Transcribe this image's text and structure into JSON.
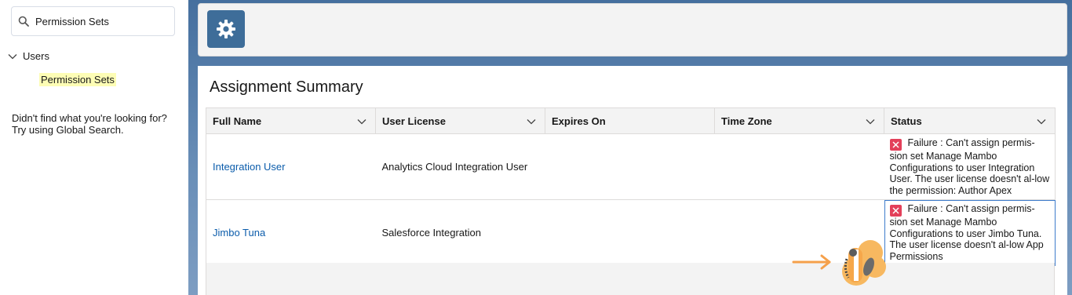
{
  "search": {
    "value": "Permission Sets"
  },
  "tree": {
    "parent_label": "Users",
    "child_label": "Permission Sets"
  },
  "help": {
    "line1": "Didn't find what you're looking for?",
    "line2": "Try using Global Search."
  },
  "page": {
    "title": "Assignment Summary"
  },
  "table": {
    "columns": [
      "Full Name",
      "User License",
      "Expires On",
      "Time Zone",
      "Status"
    ],
    "rows": [
      {
        "full_name": "Integration User",
        "user_license": "Analytics Cloud Integration User",
        "expires_on": "",
        "time_zone": "",
        "status": "Failure : Can't assign permis-sion set Manage Mambo Configurations to user Integration User. The user license doesn't al-low the permission: Author Apex"
      },
      {
        "full_name": "Jimbo Tuna",
        "user_license": "Salesforce Integration",
        "expires_on": "",
        "time_zone": "",
        "status": "Failure : Can't assign permis-sion set Manage Mambo Configurations to user Jimbo Tuna. The user license doesn't al-low App Permissions"
      }
    ]
  },
  "icons": {
    "search": "search-icon",
    "tree_chevron": "chevron-down-icon",
    "setup": "gear-icon",
    "status": "error-icon",
    "mascot": "astro-mascot-icon"
  },
  "colors": {
    "link": "#0b5cab",
    "error": "#e3405a",
    "setup_tile": "#3e6d99",
    "highlight": "#fdfdb5"
  }
}
